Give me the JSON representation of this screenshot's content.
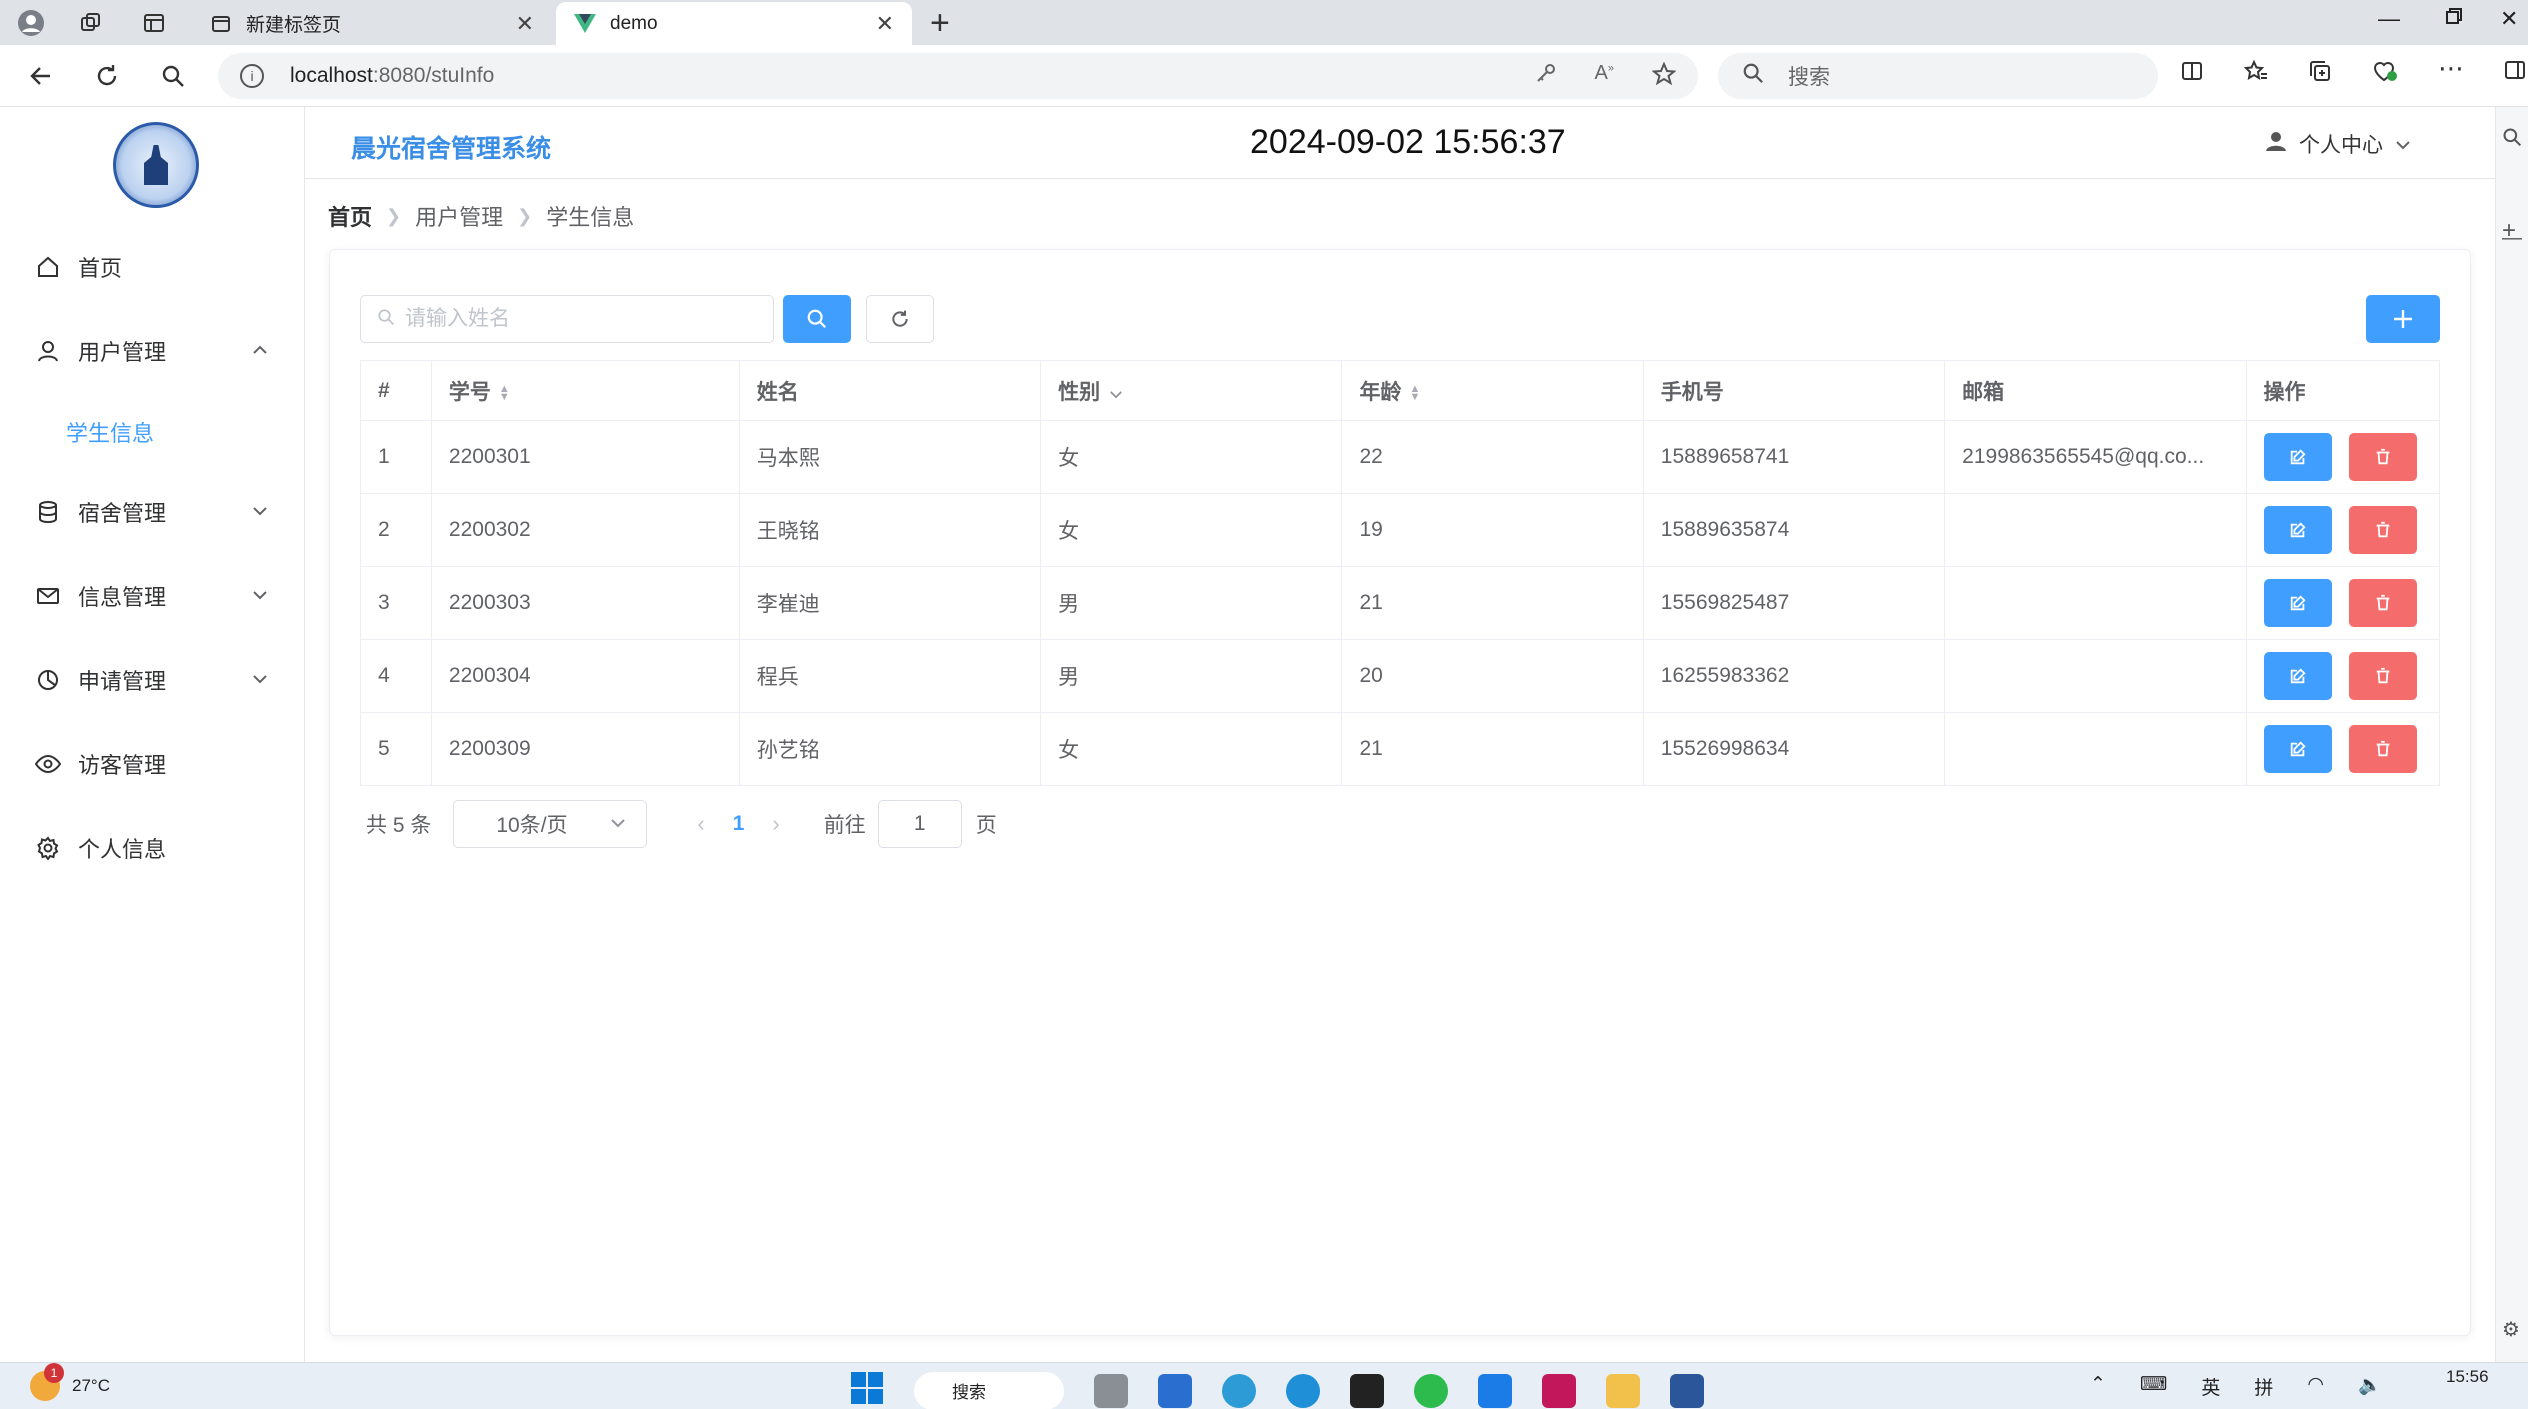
{
  "browser": {
    "tabs": [
      {
        "title": "新建标签页",
        "active": false
      },
      {
        "title": "demo",
        "active": true
      }
    ],
    "url_host": "localhost",
    "url_path": ":8080/stuInfo",
    "search_placeholder": "搜索"
  },
  "app": {
    "name": "晨光宿舍管理系统",
    "clock": "2024-09-02 15:56:37",
    "user_menu": "个人中心",
    "accent": "#409eff",
    "danger": "#f56c6c"
  },
  "sidebar": {
    "items": [
      {
        "label": "首页",
        "icon": "home-icon"
      },
      {
        "label": "用户管理",
        "icon": "user-icon",
        "expanded": true
      },
      {
        "label": "学生信息",
        "icon": "",
        "active": true
      },
      {
        "label": "宿舍管理",
        "icon": "database-icon"
      },
      {
        "label": "信息管理",
        "icon": "mail-icon"
      },
      {
        "label": "申请管理",
        "icon": "pie-chart-icon"
      },
      {
        "label": "访客管理",
        "icon": "eye-icon"
      },
      {
        "label": "个人信息",
        "icon": "gear-icon"
      }
    ]
  },
  "breadcrumb": [
    "首页",
    "用户管理",
    "学生信息"
  ],
  "search": {
    "placeholder": "请输入姓名",
    "value": ""
  },
  "table": {
    "columns": [
      "#",
      "学号",
      "姓名",
      "性别",
      "年龄",
      "手机号",
      "邮箱",
      "操作"
    ],
    "rows": [
      {
        "idx": "1",
        "id": "2200301",
        "name": "马本熙",
        "gender": "女",
        "age": "22",
        "phone": "15889658741",
        "email": "2199863565545@qq.co..."
      },
      {
        "idx": "2",
        "id": "2200302",
        "name": "王晓铭",
        "gender": "女",
        "age": "19",
        "phone": "15889635874",
        "email": ""
      },
      {
        "idx": "3",
        "id": "2200303",
        "name": "李崔迪",
        "gender": "男",
        "age": "21",
        "phone": "15569825487",
        "email": ""
      },
      {
        "idx": "4",
        "id": "2200304",
        "name": "程兵",
        "gender": "男",
        "age": "20",
        "phone": "16255983362",
        "email": ""
      },
      {
        "idx": "5",
        "id": "2200309",
        "name": "孙艺铭",
        "gender": "女",
        "age": "21",
        "phone": "15526998634",
        "email": ""
      }
    ]
  },
  "pagination": {
    "total": "共 5 条",
    "page_size": "10条/页",
    "current": "1",
    "goto_label": "前往",
    "goto_value": "1",
    "page_suffix": "页"
  },
  "taskbar": {
    "temperature": "27°C",
    "weather_badge": "1",
    "search_label": "搜索",
    "ime_lang": "英",
    "ime_mode": "拼",
    "time": "15:56"
  }
}
